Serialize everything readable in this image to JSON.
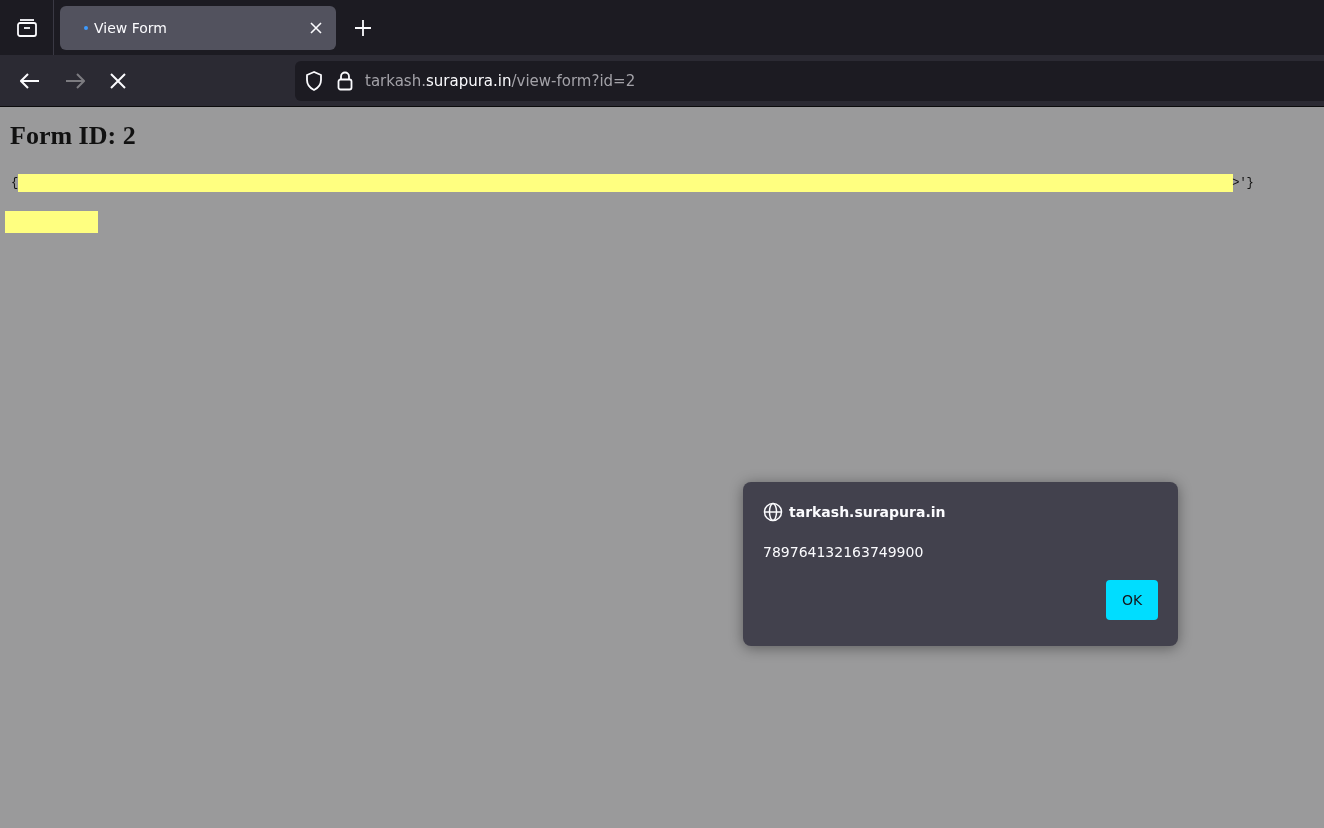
{
  "tabs": [
    {
      "label": "View Form",
      "selected": true,
      "loading": true
    }
  ],
  "url": {
    "subdomain": "tarkash.",
    "domain": "surapura.in",
    "path": "/view-form?id=2"
  },
  "page": {
    "heading": "Form ID: 2",
    "line_start": "{",
    "line_end": ">'}"
  },
  "dialog": {
    "origin": "tarkash.surapura.in",
    "message": "789764132163749900",
    "button": "OK"
  }
}
